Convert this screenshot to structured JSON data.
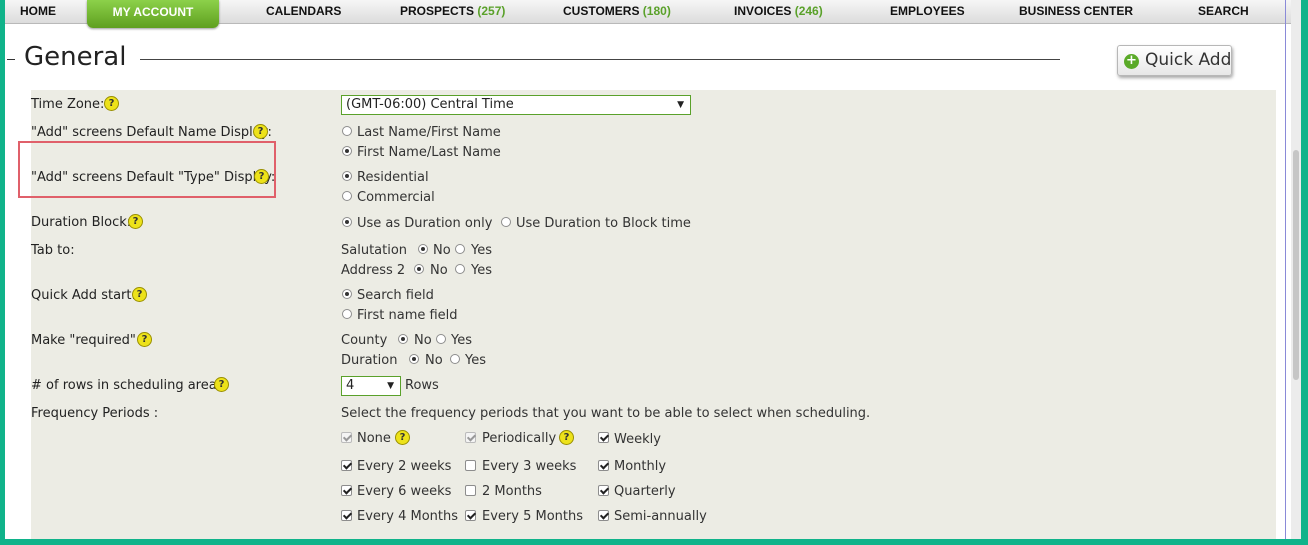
{
  "nav": {
    "items": [
      {
        "label": "HOME",
        "count": ""
      },
      {
        "label": "CALENDARS",
        "count": ""
      },
      {
        "label": "PROSPECTS",
        "count": "(257)"
      },
      {
        "label": "CUSTOMERS",
        "count": "(180)"
      },
      {
        "label": "INVOICES",
        "count": "(246)"
      },
      {
        "label": "EMPLOYEES",
        "count": ""
      },
      {
        "label": "BUSINESS CENTER",
        "count": ""
      },
      {
        "label": "SEARCH",
        "count": ""
      }
    ],
    "active": "MY ACCOUNT"
  },
  "page": {
    "title": "General"
  },
  "quick_add": {
    "label": "Quick Add",
    "icon": "plus-circle-icon",
    "icon_glyph": "+",
    "icon_color": "#5aaa28"
  },
  "help_glyph": "?",
  "accent_color": "#5aa12a",
  "highlight_color": "#e0606a",
  "settings": {
    "time_zone": {
      "label": "Time Zone:",
      "value": "(GMT-06:00) Central Time"
    },
    "name_display": {
      "label": "\"Add\" screens Default Name Display:",
      "options": [
        "Last Name/First Name",
        "First Name/Last Name"
      ],
      "selected": 1
    },
    "type_display": {
      "label": "\"Add\" screens Default \"Type\" Display:",
      "options": [
        "Residential",
        "Commercial"
      ],
      "selected": 0
    },
    "duration_block": {
      "label": "Duration Block:",
      "options": [
        "Use as Duration only",
        "Use Duration to Block time"
      ],
      "selected": 0
    },
    "tab_to": {
      "label": "Tab to:",
      "rows": [
        {
          "name": "Salutation",
          "no": "No",
          "yes": "Yes",
          "selected": "no"
        },
        {
          "name": "Address 2",
          "no": "No",
          "yes": "Yes",
          "selected": "no"
        }
      ]
    },
    "quick_add_start": {
      "label": "Quick Add start:",
      "options": [
        "Search field",
        "First name field"
      ],
      "selected": 0
    },
    "make_required": {
      "label": "Make \"required\" :",
      "rows": [
        {
          "name": "County",
          "no": "No",
          "yes": "Yes",
          "selected": "no"
        },
        {
          "name": "Duration",
          "no": "No",
          "yes": "Yes",
          "selected": "no"
        }
      ]
    },
    "rows_scheduling": {
      "label": "# of rows in scheduling areas:",
      "value": "4",
      "suffix": "Rows"
    },
    "frequency": {
      "label": "Frequency Periods :",
      "hint": "Select the frequency periods that you want to be able to select when scheduling.",
      "col1": [
        {
          "label": "None",
          "checked": true,
          "disabled": true
        },
        {
          "label": "Every 2 weeks",
          "checked": true,
          "disabled": false
        },
        {
          "label": "Every 6 weeks",
          "checked": true,
          "disabled": false
        },
        {
          "label": "Every 4 Months",
          "checked": true,
          "disabled": false
        }
      ],
      "col2": [
        {
          "label": "Periodically",
          "checked": true,
          "disabled": true
        },
        {
          "label": "Every 3 weeks",
          "checked": false,
          "disabled": false
        },
        {
          "label": "2 Months",
          "checked": false,
          "disabled": false
        },
        {
          "label": "Every 5 Months",
          "checked": true,
          "disabled": false
        }
      ],
      "col3": [
        {
          "label": "Weekly",
          "checked": true,
          "disabled": false
        },
        {
          "label": "Monthly",
          "checked": true,
          "disabled": false
        },
        {
          "label": "Quarterly",
          "checked": true,
          "disabled": false
        },
        {
          "label": "Semi-annually",
          "checked": true,
          "disabled": false
        }
      ]
    }
  }
}
